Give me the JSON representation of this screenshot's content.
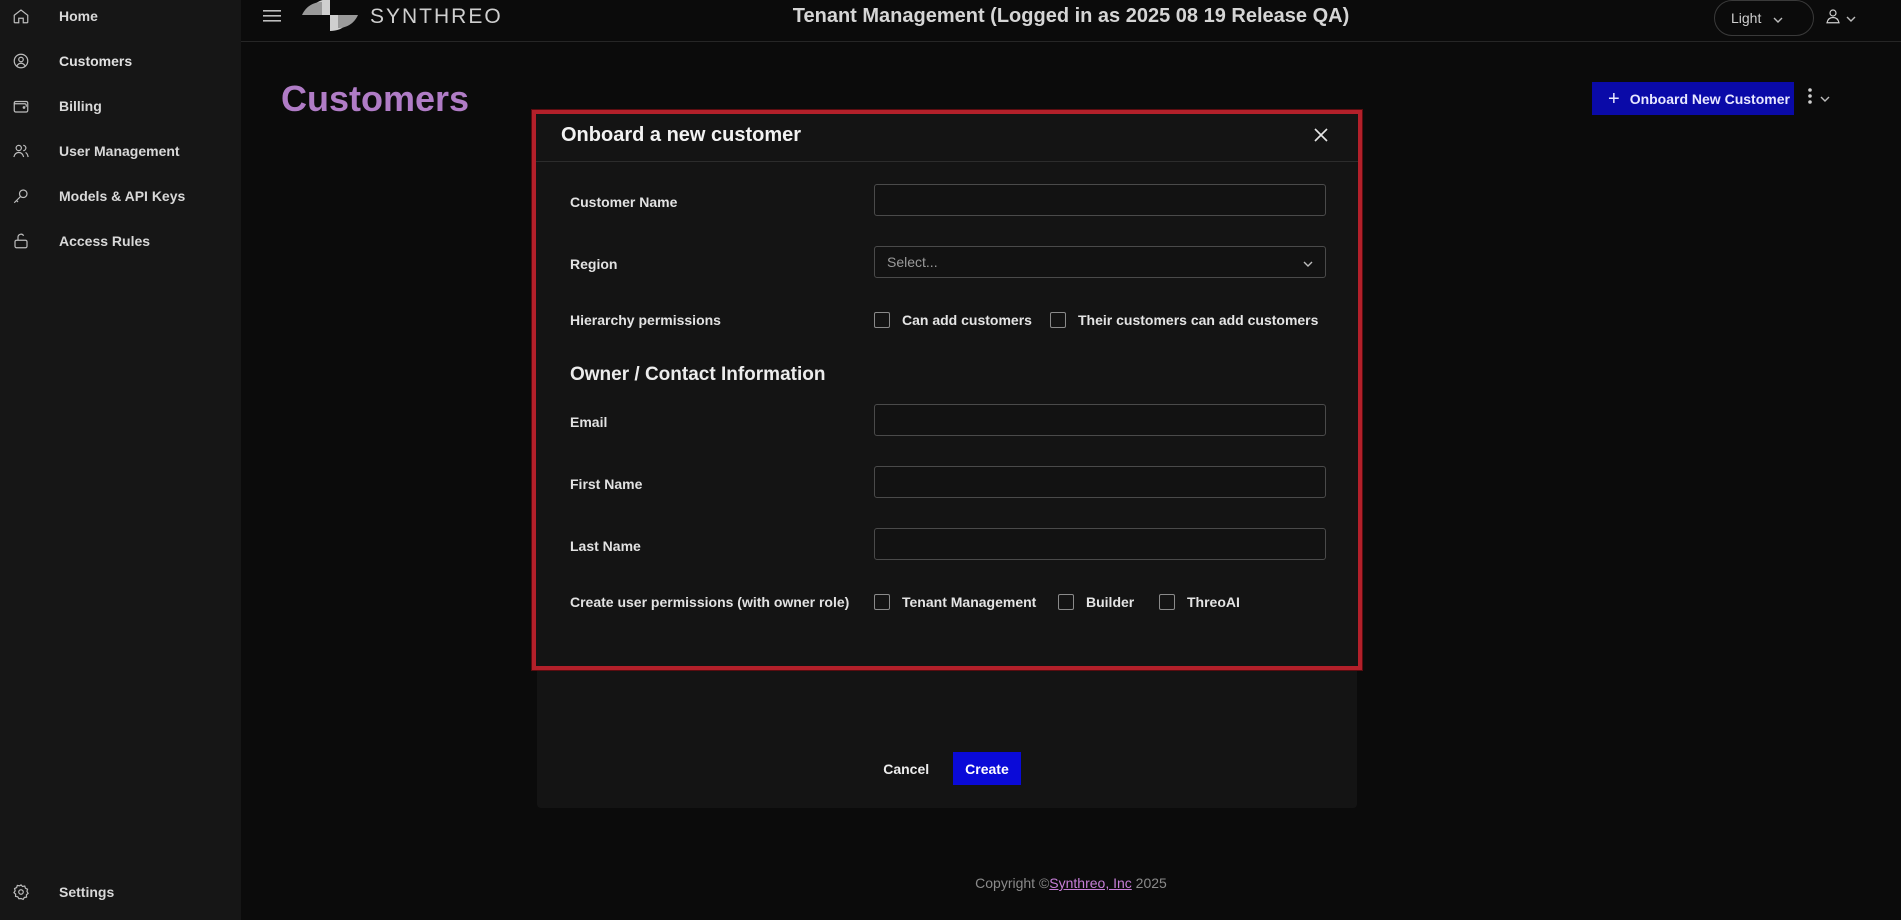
{
  "sidebar": {
    "items": [
      {
        "label": "Home",
        "icon": "home-icon"
      },
      {
        "label": "Customers",
        "icon": "customers-icon"
      },
      {
        "label": "Billing",
        "icon": "wallet-icon"
      },
      {
        "label": "User Management",
        "icon": "users-icon"
      },
      {
        "label": "Models & API Keys",
        "icon": "key-icon"
      },
      {
        "label": "Access Rules",
        "icon": "unlock-icon"
      }
    ],
    "settings_label": "Settings"
  },
  "header": {
    "logo_text": "SYNTHREO",
    "title": "Tenant Management (Logged in as 2025 08 19 Release QA)",
    "theme_label": "Light"
  },
  "page": {
    "title": "Customers",
    "onboard_button_label": "Onboard New Customer"
  },
  "modal": {
    "title": "Onboard a new customer",
    "fields": {
      "customer_name_label": "Customer Name",
      "customer_name_value": "",
      "region_label": "Region",
      "region_placeholder": "Select...",
      "hierarchy_label": "Hierarchy permissions",
      "hierarchy_options": [
        "Can add customers",
        "Their customers can add customers"
      ],
      "section_title": "Owner / Contact Information",
      "email_label": "Email",
      "email_value": "",
      "first_name_label": "First Name",
      "first_name_value": "",
      "last_name_label": "Last Name",
      "last_name_value": "",
      "user_permissions_label": "Create user permissions (with owner role)",
      "user_permission_options": [
        "Tenant Management",
        "Builder",
        "ThreoAI"
      ]
    },
    "cancel_label": "Cancel",
    "create_label": "Create"
  },
  "footer": {
    "prefix": "Copyright ©",
    "link": "Synthreo, Inc",
    "year": " 2025"
  },
  "colors": {
    "accent_purple": "#b07cc6",
    "primary_blue": "#0a0ad8",
    "modal_border": "#b3202a"
  }
}
